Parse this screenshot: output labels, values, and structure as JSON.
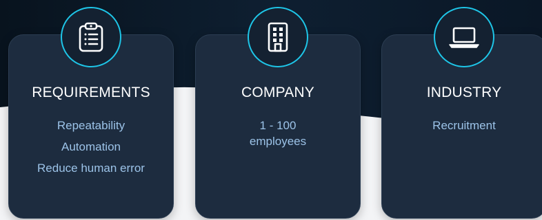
{
  "colors": {
    "card_bg": "#1d2c3f",
    "accent": "#1ec6e8",
    "title": "#ffffff",
    "item_text": "#9cc3e8",
    "dark_bg": "#0c1a28",
    "light_bg": "#f3f4f6"
  },
  "cards": [
    {
      "icon": "clipboard-list-icon",
      "title": "REQUIREMENTS",
      "items": [
        "Repeatability",
        "Automation",
        "Reduce human error"
      ]
    },
    {
      "icon": "building-icon",
      "title": "COMPANY",
      "items": [
        "1 - 100 employees"
      ]
    },
    {
      "icon": "laptop-icon",
      "title": "INDUSTRY",
      "items": [
        "Recruitment"
      ]
    }
  ]
}
